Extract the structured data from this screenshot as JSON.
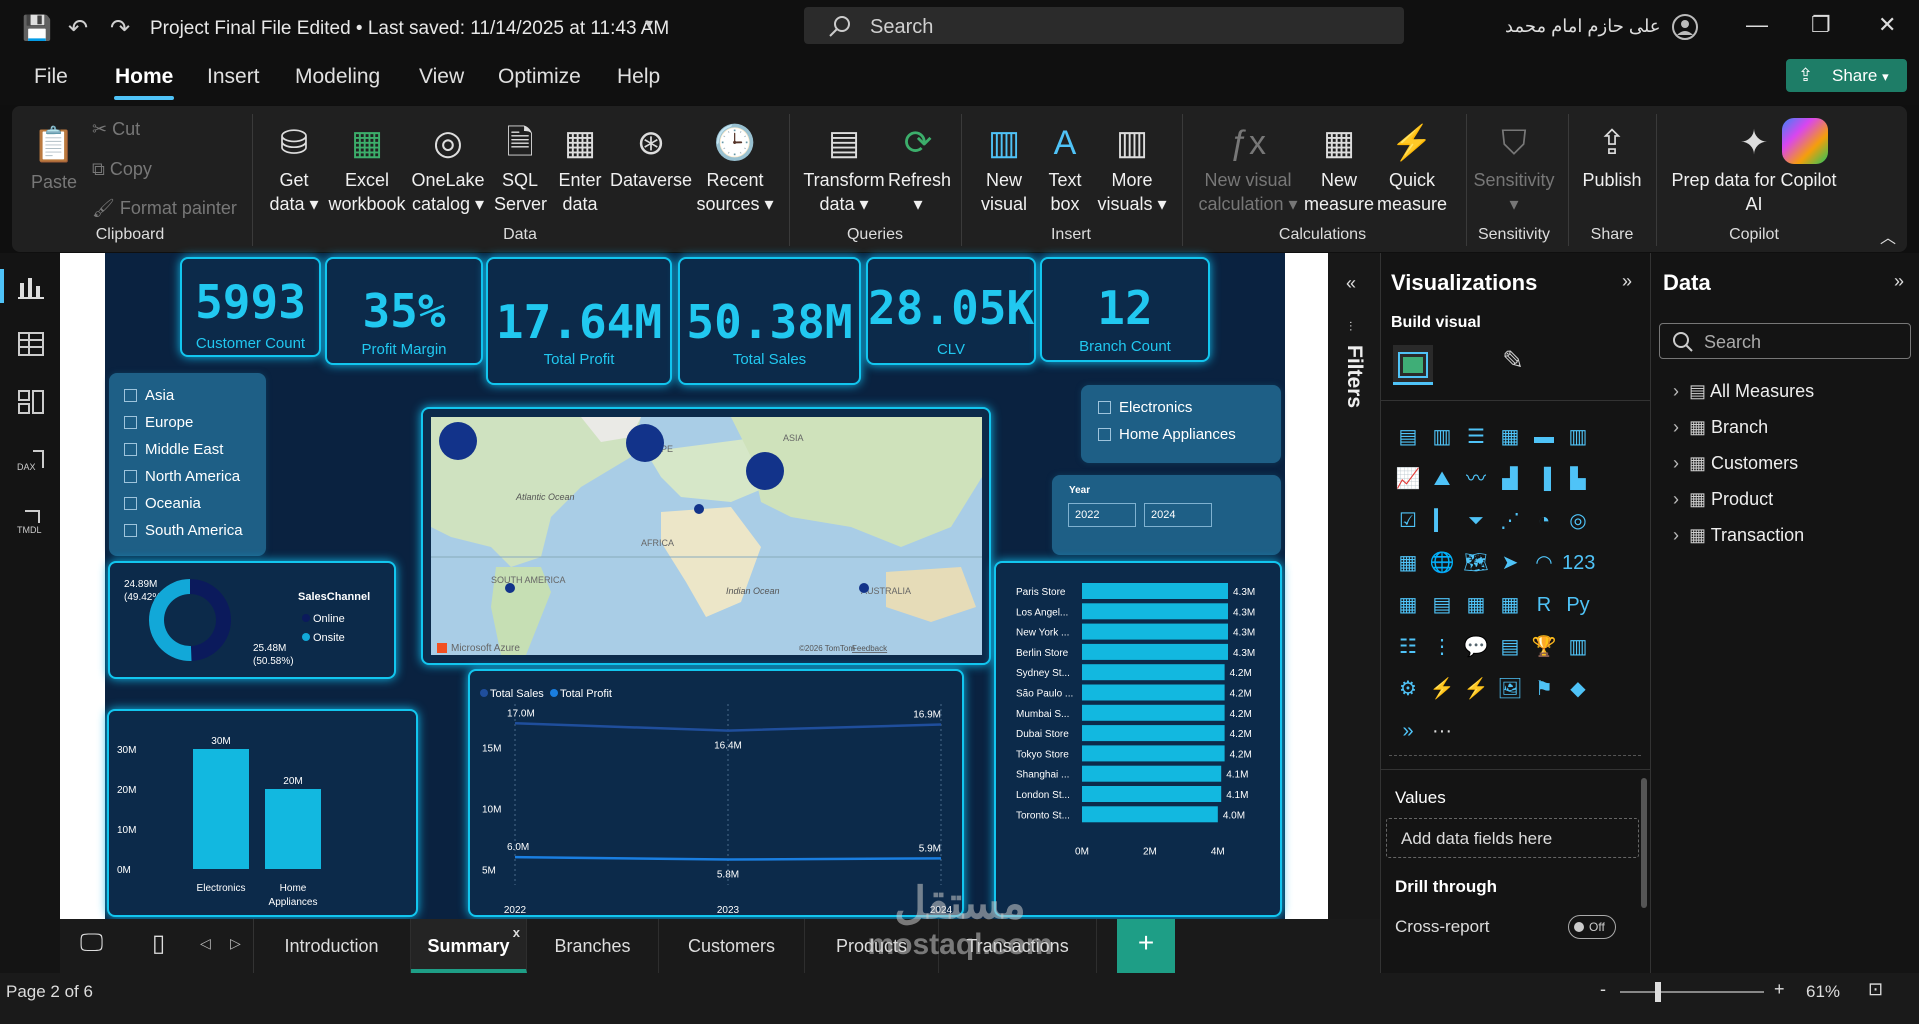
{
  "window": {
    "title": "Project Final File Edited • Last saved: 11/14/2025 at 11:43 AM",
    "search_placeholder": "Search",
    "user": "علی حازم امام محمد"
  },
  "menu": {
    "items": [
      "File",
      "Home",
      "Insert",
      "Modeling",
      "View",
      "Optimize",
      "Help"
    ],
    "active": "Home",
    "share": "Share"
  },
  "ribbon": {
    "clipboard": {
      "paste": "Paste",
      "cut": "Cut",
      "copy": "Copy",
      "format_painter": "Format painter",
      "group": "Clipboard"
    },
    "data": {
      "get_data": [
        "Get",
        "data"
      ],
      "excel": [
        "Excel",
        "workbook"
      ],
      "onelake": [
        "OneLake",
        "catalog"
      ],
      "sql": [
        "SQL",
        "Server"
      ],
      "enter": [
        "Enter",
        "data"
      ],
      "dataverse": "Dataverse",
      "recent": [
        "Recent",
        "sources"
      ],
      "group": "Data"
    },
    "queries": {
      "transform": [
        "Transform",
        "data"
      ],
      "refresh": "Refresh",
      "group": "Queries"
    },
    "insert": {
      "new_visual": [
        "New",
        "visual"
      ],
      "text_box": [
        "Text",
        "box"
      ],
      "more_visuals": [
        "More",
        "visuals"
      ],
      "group": "Insert"
    },
    "calculations": {
      "new_visual_calc": [
        "New visual",
        "calculation"
      ],
      "new_measure": [
        "New",
        "measure"
      ],
      "quick_measure": [
        "Quick",
        "measure"
      ],
      "group": "Calculations"
    },
    "sensitivity": {
      "label": "Sensitivity",
      "group": "Sensitivity"
    },
    "share": {
      "publish": "Publish",
      "group": "Share"
    },
    "copilot": {
      "prep": [
        "Prep data for Copilot",
        "AI"
      ],
      "group": "Copilot"
    }
  },
  "kpis": [
    {
      "value": "5993",
      "label": "Customer Count"
    },
    {
      "value": "35%",
      "label": "Profit Margin"
    },
    {
      "value": "17.64M",
      "label": "Total Profit"
    },
    {
      "value": "50.38M",
      "label": "Total Sales"
    },
    {
      "value": "28.05K",
      "label": "CLV"
    },
    {
      "value": "12",
      "label": "Branch Count"
    }
  ],
  "region_slicer": [
    "Asia",
    "Europe",
    "Middle East",
    "North America",
    "Oceania",
    "South America"
  ],
  "category_slicer": [
    "Electronics",
    "Home Appliances"
  ],
  "year_slicer": {
    "title": "Year",
    "from": "2022",
    "to": "2024"
  },
  "map": {
    "labels": [
      "Atlantic Ocean",
      "ASIA",
      "AFRICA",
      "SOUTH AMERICA",
      "Indian Ocean",
      "AUSTRALIA",
      "OPE"
    ],
    "brand": "Microsoft Azure",
    "credit": "©2026 TomTom",
    "feedback": "Feedback"
  },
  "chart_data": [
    {
      "type": "pie",
      "title": "",
      "legend_title": "SalesChannel",
      "categories": [
        "Online",
        "Onsite"
      ],
      "values": [
        24.89,
        25.48
      ],
      "labels": [
        "24.89M",
        "(49.42%)",
        "25.48M",
        "(50.58%)"
      ],
      "colors": [
        "#0b1a5c",
        "#12a8d8"
      ]
    },
    {
      "type": "bar",
      "categories": [
        "Electronics",
        "Home Appliances"
      ],
      "category_lines": [
        [
          "Electronics"
        ],
        [
          "Home",
          "Appliances"
        ]
      ],
      "values": [
        30,
        20
      ],
      "data_labels": [
        "30M",
        "20M"
      ],
      "ylim": [
        0,
        30
      ],
      "yticks": [
        "0M",
        "10M",
        "20M",
        "30M"
      ]
    },
    {
      "type": "line",
      "x": [
        "2022",
        "2023",
        "2024"
      ],
      "series": [
        {
          "name": "Total Sales",
          "values": [
            17.0,
            16.4,
            16.9
          ],
          "labels": [
            "17.0M",
            "16.4M",
            "16.9M"
          ]
        },
        {
          "name": "Total Profit",
          "values": [
            6.0,
            5.8,
            5.9
          ],
          "labels": [
            "6.0M",
            "5.8M",
            "5.9M"
          ]
        }
      ],
      "ylim": [
        4.2,
        17.6
      ],
      "yticks": [
        "5M",
        "10M",
        "15M"
      ]
    },
    {
      "type": "bar",
      "orientation": "horizontal",
      "categories": [
        "Paris Store",
        "Los Angel...",
        "New York ...",
        "Berlin Store",
        "Sydney St...",
        "São Paulo ...",
        "Mumbai S...",
        "Dubai Store",
        "Tokyo Store",
        "Shanghai ...",
        "London St...",
        "Toronto St..."
      ],
      "values": [
        4.3,
        4.3,
        4.3,
        4.3,
        4.2,
        4.2,
        4.2,
        4.2,
        4.2,
        4.1,
        4.1,
        4.0
      ],
      "labels": [
        "4.3M",
        "4.3M",
        "4.3M",
        "4.3M",
        "4.2M",
        "4.2M",
        "4.2M",
        "4.2M",
        "4.2M",
        "4.1M",
        "4.1M",
        "4.0M"
      ],
      "xlim": [
        0,
        4.3
      ],
      "xticks": [
        "0M",
        "2M",
        "4M"
      ]
    }
  ],
  "filters": {
    "label": "Filters"
  },
  "visualizations": {
    "title": "Visualizations",
    "build": "Build visual",
    "values": "Values",
    "add_fields": "Add data fields here",
    "drill": "Drill through",
    "cross_report": "Cross-report",
    "off": "Off",
    "more": "···"
  },
  "data_pane": {
    "title": "Data",
    "search": "Search",
    "items": [
      "All Measures",
      "Branch",
      "Customers",
      "Product",
      "Transaction"
    ]
  },
  "tabs": [
    "Introduction",
    "Summary",
    "Branches",
    "Customers",
    "Products",
    "Transactions"
  ],
  "active_tab": "Summary",
  "status": {
    "page": "Page 2 of 6",
    "zoom": "61%"
  },
  "watermark": {
    "arabic": "مستقل",
    "latin": "mostaql.com"
  }
}
